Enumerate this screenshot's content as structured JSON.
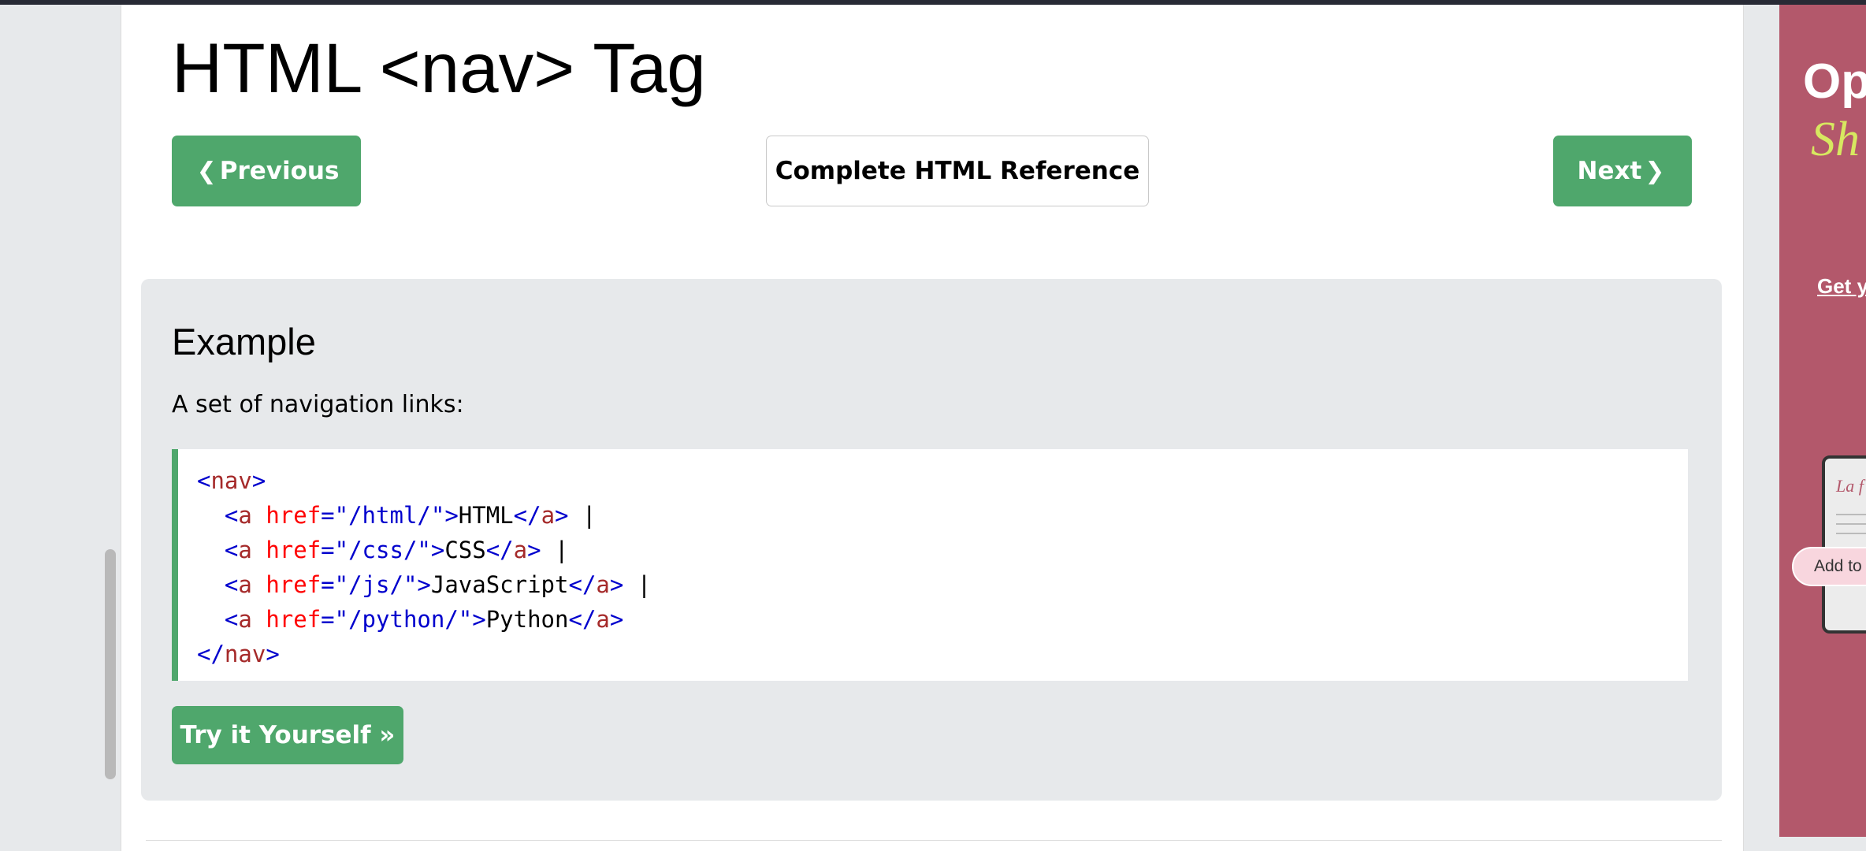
{
  "page": {
    "title": "HTML <nav> Tag"
  },
  "nav_buttons": {
    "previous": {
      "chevron": "❮",
      "label": "Previous"
    },
    "reference": "Complete HTML Reference",
    "next": {
      "label": "Next",
      "chevron": "❯"
    }
  },
  "example": {
    "heading": "Example",
    "description": "A set of navigation links:",
    "try_button": "Try it Yourself »",
    "code": {
      "open_tag": "nav",
      "links": [
        {
          "href": "\"/html/\"",
          "text": "HTML",
          "sep": " |"
        },
        {
          "href": "\"/css/\"",
          "text": "CSS",
          "sep": " |"
        },
        {
          "href": "\"/js/\"",
          "text": "JavaScript",
          "sep": " |"
        },
        {
          "href": "\"/python/\"",
          "text": "Python",
          "sep": ""
        }
      ],
      "link_tag": "a",
      "attr": "href",
      "close_tag": "nav"
    }
  },
  "ad": {
    "title": "Op",
    "subtitle": "Sh",
    "link": "Get y",
    "laptop_text": "La f",
    "pill": "Add to"
  },
  "colors": {
    "accent_green": "#4fa76c",
    "ad_background": "#b3586b"
  }
}
